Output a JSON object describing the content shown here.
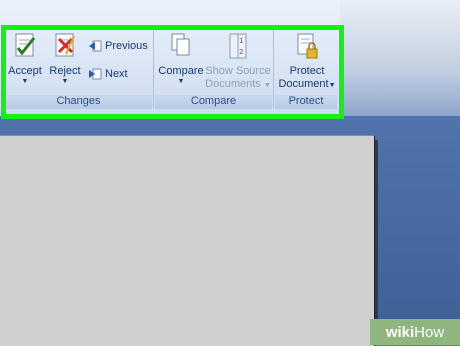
{
  "changes": {
    "group_label": "Changes",
    "accept_label": "Accept",
    "reject_label": "Reject",
    "previous_label": "Previous",
    "next_label": "Next"
  },
  "compare": {
    "group_label": "Compare",
    "compare_label": "Compare",
    "show_source_line1": "Show Source",
    "show_source_line2": "Documents"
  },
  "protect": {
    "group_label": "Protect",
    "protect_line1": "Protect",
    "protect_line2": "Document"
  },
  "watermark": {
    "brand_a": "wiki",
    "brand_b": "How"
  },
  "colors": {
    "highlight": "#14f014",
    "ribbon_text": "#163a73",
    "group_label_text": "#2d4f86"
  }
}
